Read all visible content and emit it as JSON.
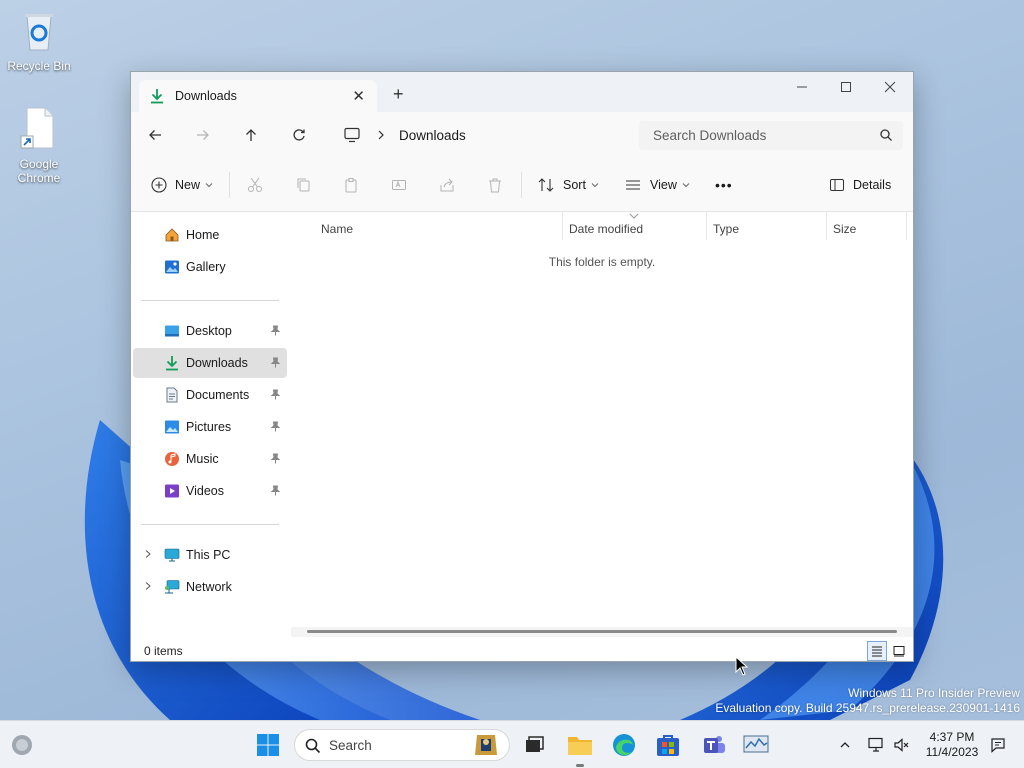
{
  "desktop": {
    "icons": [
      {
        "label": "Recycle Bin"
      },
      {
        "label": "Google Chrome"
      }
    ],
    "watermark": {
      "line1": "Windows 11 Pro Insider Preview",
      "line2": "Evaluation copy. Build 25947.rs_prerelease.230901-1416"
    }
  },
  "explorer": {
    "tab": {
      "title": "Downloads",
      "close_icon": "close-icon"
    },
    "new_tab_icon": "plus-icon",
    "address": {
      "location": "Downloads"
    },
    "search": {
      "placeholder": "Search Downloads"
    },
    "toolbar": {
      "new_label": "New",
      "sort_label": "Sort",
      "view_label": "View",
      "more_label": "•••",
      "details_label": "Details"
    },
    "sidebar": {
      "top": [
        {
          "label": "Home",
          "icon": "home-icon"
        },
        {
          "label": "Gallery",
          "icon": "gallery-icon"
        }
      ],
      "quick_access": [
        {
          "label": "Desktop",
          "icon": "desktop-folder-icon"
        },
        {
          "label": "Downloads",
          "icon": "download-icon",
          "selected": true
        },
        {
          "label": "Documents",
          "icon": "documents-icon"
        },
        {
          "label": "Pictures",
          "icon": "pictures-icon"
        },
        {
          "label": "Music",
          "icon": "music-icon"
        },
        {
          "label": "Videos",
          "icon": "videos-icon"
        }
      ],
      "bottom": [
        {
          "label": "This PC",
          "icon": "this-pc-icon"
        },
        {
          "label": "Network",
          "icon": "network-icon"
        }
      ]
    },
    "columns": [
      "Name",
      "Date modified",
      "Type",
      "Size"
    ],
    "empty_message": "This folder is empty.",
    "status": {
      "count": "0 items"
    }
  },
  "taskbar": {
    "search_label": "Search",
    "clock": {
      "time": "4:37 PM",
      "date": "11/4/2023"
    }
  },
  "colors": {
    "accent": "#0067c0",
    "download_green": "#0f9d58",
    "selected_bg": "#e0e0e0"
  }
}
